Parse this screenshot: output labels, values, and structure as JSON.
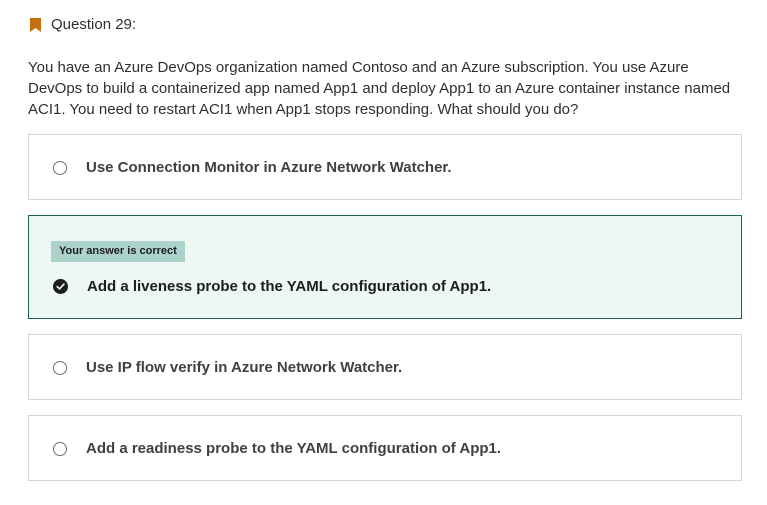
{
  "header": {
    "title": "Question 29:",
    "bookmark_color": "#c4710d"
  },
  "question": {
    "text": "You have an Azure DevOps organization named Contoso and an Azure subscription. You use Azure DevOps to build a containerized app named App1 and deploy App1 to an Azure container instance named ACI1. You need to restart ACI1 when App1 stops responding. What should you do?"
  },
  "options": [
    {
      "label": "Use Connection Monitor in Azure Network Watcher.",
      "state": "unselected"
    },
    {
      "label": "Add a liveness probe to the YAML configuration of App1.",
      "state": "selected-correct",
      "feedback": "Your answer is correct"
    },
    {
      "label": "Use IP flow verify in Azure Network Watcher.",
      "state": "unselected"
    },
    {
      "label": "Add a readiness probe to the YAML configuration of App1.",
      "state": "unselected"
    }
  ],
  "colors": {
    "correct_border": "#1e6055",
    "correct_bg": "#eef8f3",
    "badge_bg": "#acd2cc",
    "default_border": "#d1d7dc"
  }
}
